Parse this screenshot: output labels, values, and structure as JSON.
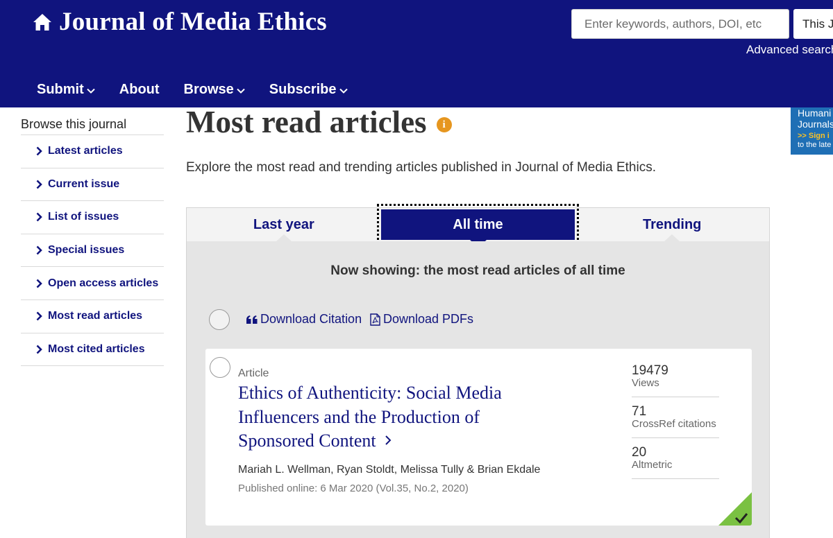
{
  "header": {
    "journal_title": "Journal of Media Ethics",
    "search_placeholder": "Enter keywords, authors, DOI, etc",
    "scope_selected": "This Jo",
    "advanced_search": "Advanced search",
    "nav": [
      {
        "label": "Submit",
        "has_dropdown": true
      },
      {
        "label": "About",
        "has_dropdown": false
      },
      {
        "label": "Browse",
        "has_dropdown": true
      },
      {
        "label": "Subscribe",
        "has_dropdown": true
      }
    ],
    "colors": {
      "header_bg": "#10147e",
      "link": "#10147e",
      "accent_orange": "#e6961f",
      "badge_green": "#7ac142"
    }
  },
  "promo": {
    "line1": "Humani",
    "line2": "Journals",
    "line3": ">> Sign i",
    "line4": "to the late"
  },
  "sidebar": {
    "title": "Browse this journal",
    "items": [
      {
        "label": "Latest articles"
      },
      {
        "label": "Current issue"
      },
      {
        "label": "List of issues"
      },
      {
        "label": "Special issues"
      },
      {
        "label": "Open access articles"
      },
      {
        "label": "Most read articles"
      },
      {
        "label": "Most cited articles"
      }
    ]
  },
  "main": {
    "title": "Most read articles",
    "info_icon": "i",
    "intro": "Explore the most read and trending articles published in Journal of Media Ethics.",
    "tabs": [
      {
        "label": "Last year",
        "active": false
      },
      {
        "label": "All time",
        "active": true
      },
      {
        "label": "Trending",
        "active": false
      }
    ],
    "now_showing": "Now showing: the most read articles of all time",
    "toolbar": {
      "download_citation": "Download Citation",
      "download_pdfs": "Download PDFs"
    },
    "articles": [
      {
        "type": "Article",
        "title": "Ethics of Authenticity: Social Media Influencers and the Production of Sponsored Content",
        "authors": "Mariah L. Wellman, Ryan Stoldt, Melissa Tully & Brian Ekdale",
        "published": "Published online: 6 Mar 2020 (Vol.35, No.2, 2020)",
        "metrics": [
          {
            "value": "19479",
            "label": "Views"
          },
          {
            "value": "71",
            "label": "CrossRef citations"
          },
          {
            "value": "20",
            "label": "Altmetric"
          }
        ]
      }
    ]
  }
}
